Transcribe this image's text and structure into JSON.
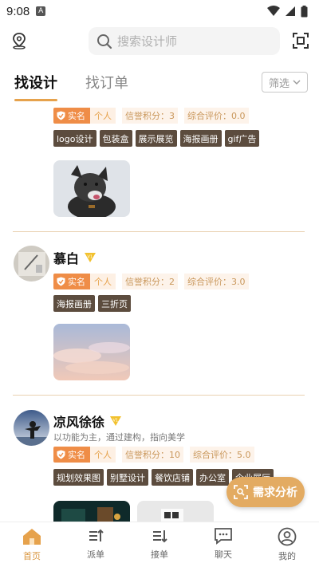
{
  "status": {
    "time": "9:08",
    "notif_letter": "A"
  },
  "search": {
    "placeholder": "搜索设计师"
  },
  "tabs": [
    {
      "label": "找设计"
    },
    {
      "label": "找订单"
    }
  ],
  "filter": {
    "label": "筛选"
  },
  "designers": [
    {
      "name": "",
      "verified_label": "实名",
      "type_label": "个人",
      "credit": "信誉积分：3",
      "rating": "综合评价：0.0",
      "tags": [
        "logo设计",
        "包装盒",
        "展示展览",
        "海报画册",
        "gif广告"
      ]
    },
    {
      "name": "慕白",
      "verified_label": "实名",
      "type_label": "个人",
      "credit": "信誉积分：2",
      "rating": "综合评价：3.0",
      "tags": [
        "海报画册",
        "三折页"
      ]
    },
    {
      "name": "凉风徐徐",
      "bio": "以功能为主，通过建构，指向美学",
      "verified_label": "实名",
      "type_label": "个人",
      "credit": "信誉积分：10",
      "rating": "综合评价：5.0",
      "tags": [
        "规划效果图",
        "别墅设计",
        "餐饮店铺",
        "办公室",
        "企业展厅"
      ]
    }
  ],
  "fab": {
    "label": "需求分析"
  },
  "nav": [
    {
      "label": "首页",
      "icon": "home-icon"
    },
    {
      "label": "派单",
      "icon": "dispatch-icon"
    },
    {
      "label": "接单",
      "icon": "receive-order-icon"
    },
    {
      "label": "聊天",
      "icon": "chat-icon"
    },
    {
      "label": "我的",
      "icon": "profile-icon"
    }
  ],
  "colors": {
    "accent": "#e6a24c",
    "tag_bg": "#5c4c3e",
    "verified": "#ef8d47"
  }
}
